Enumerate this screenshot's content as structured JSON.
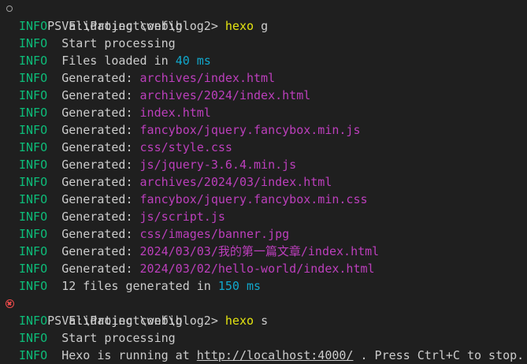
{
  "terminal": {
    "prompt": "PS E:\\Project\\web\\blog2>",
    "info_tag": "INFO",
    "block1": {
      "cmd": "hexo",
      "arg": "g",
      "validating": "Validating config",
      "start": "Start processing",
      "files_loaded_prefix": "Files loaded in",
      "files_loaded_num": "40 ms",
      "generated_label": "Generated:",
      "generated": [
        "archives/index.html",
        "archives/2024/index.html",
        "index.html",
        "fancybox/jquery.fancybox.min.js",
        "css/style.css",
        "js/jquery-3.6.4.min.js",
        "archives/2024/03/index.html",
        "fancybox/jquery.fancybox.min.css",
        "js/script.js",
        "css/images/banner.jpg",
        "2024/03/03/我的第一篇文章/index.html",
        "2024/03/02/hello-world/index.html"
      ],
      "summary_prefix": "12 files generated in",
      "summary_num": "150 ms"
    },
    "block2": {
      "cmd": "hexo",
      "arg": "s",
      "validating": "Validating config",
      "start": "Start processing",
      "running_prefix": "Hexo is running at",
      "running_url": "http://localhost:4000/",
      "running_suffix": ". Press Ctrl+C to stop."
    },
    "colors": {
      "background": "#1f1f1f",
      "info": "#0dbc79",
      "path": "#bc3fbc",
      "number": "#11a8cd",
      "command": "#e5e510",
      "error_marker": "#f14c4c"
    }
  }
}
